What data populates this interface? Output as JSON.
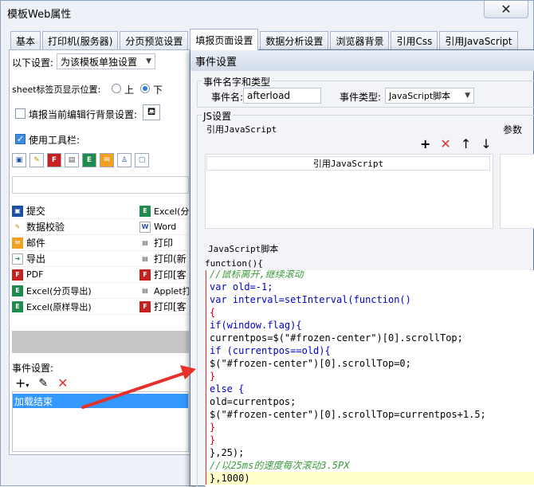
{
  "main_window": {
    "title": "模板Web属性",
    "close_label": "✕",
    "tabs": [
      {
        "label": "基本"
      },
      {
        "label": "打印机(服务器)"
      },
      {
        "label": "分页预览设置"
      },
      {
        "label": "填报页面设置"
      },
      {
        "label": "数据分析设置"
      },
      {
        "label": "浏览器背景"
      },
      {
        "label": "引用Css"
      },
      {
        "label": "引用JavaScript"
      }
    ],
    "settings": {
      "scope_label": "以下设置:",
      "scope_value": "为该模板单独设置",
      "sheet_pos_label": "sheet标签页显示位置:",
      "pos_up": "上",
      "pos_down": "下",
      "bg_label": "填报当前编辑行背景设置:",
      "toolbar_label": "使用工具栏:"
    },
    "button_list": [
      {
        "left": "提交",
        "right": "Excel(分"
      },
      {
        "left": "数据校验",
        "right": "Word"
      },
      {
        "left": "邮件",
        "right": "打印"
      },
      {
        "left": "导出",
        "right": "打印(新"
      },
      {
        "left": "PDF",
        "right": "打印[客"
      },
      {
        "left": "Excel(分页导出)",
        "right": "Applet打"
      },
      {
        "left": "Excel(原样导出)",
        "right": "打印[客"
      }
    ],
    "events_label": "事件设置:",
    "event_item": "加载结束"
  },
  "event_dialog": {
    "title": "事件设置",
    "name_type_group": "事件名字和类型",
    "name_label": "事件名:",
    "name_value": "afterload",
    "type_label": "事件类型:",
    "type_value": "JavaScript脚本",
    "js_group": "JS设置",
    "ref_js_label": "引用JavaScript",
    "params_label": "参数",
    "ref_js_header": "引用JavaScript",
    "script_label": "JavaScript脚本",
    "func_header": "function(){",
    "code_lines": [
      "//鼠标离开,继续滚动",
      "var old=-1;",
      "var interval=setInterval(function()",
      "{",
      "if(window.flag){",
      "currentpos=$(\"#frozen-center\")[0].scrollTop;",
      "if (currentpos==old){",
      "$(\"#frozen-center\")[0].scrollTop=0;",
      "}",
      "else {",
      "old=currentpos;",
      "$(\"#frozen-center\")[0].scrollTop=currentpos+1.5;",
      "}",
      "}",
      "},25);",
      "//以25ms的速度每次滚动3.5PX",
      "},1000)"
    ]
  },
  "colors": {
    "accent": "#3399ff",
    "arrow": "#e8302a",
    "keyword": "#0000cc",
    "string": "#c80000",
    "comment": "#3b9b3b"
  }
}
